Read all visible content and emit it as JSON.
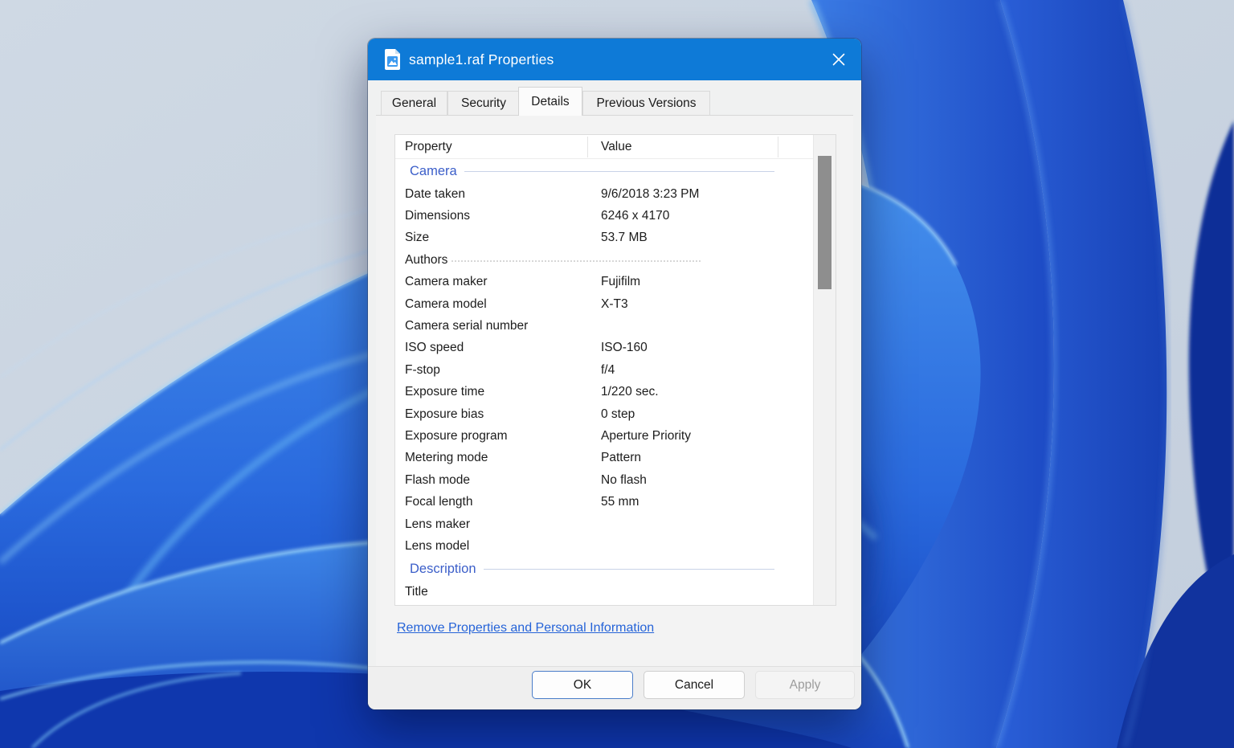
{
  "window": {
    "title": "sample1.raf Properties",
    "icon": "image-file-icon",
    "close": "close"
  },
  "tabs": [
    {
      "label": "General",
      "active": false
    },
    {
      "label": "Security",
      "active": false
    },
    {
      "label": "Details",
      "active": true
    },
    {
      "label": "Previous Versions",
      "active": false
    }
  ],
  "details": {
    "columns": {
      "property": "Property",
      "value": "Value"
    },
    "groups": [
      {
        "name": "Camera",
        "rows": [
          {
            "property": "Date taken",
            "value": "9/6/2018 3:23 PM"
          },
          {
            "property": "Dimensions",
            "value": "6246 x 4170"
          },
          {
            "property": "Size",
            "value": "53.7 MB"
          },
          {
            "property": "Authors",
            "value": "",
            "dashed": true
          },
          {
            "property": "Camera maker",
            "value": "Fujifilm"
          },
          {
            "property": "Camera model",
            "value": "X-T3"
          },
          {
            "property": "Camera serial number",
            "value": ""
          },
          {
            "property": "ISO speed",
            "value": "ISO-160"
          },
          {
            "property": "F-stop",
            "value": "f/4"
          },
          {
            "property": "Exposure time",
            "value": "1/220 sec."
          },
          {
            "property": "Exposure bias",
            "value": "0 step"
          },
          {
            "property": "Exposure program",
            "value": "Aperture Priority"
          },
          {
            "property": "Metering mode",
            "value": "Pattern"
          },
          {
            "property": "Flash mode",
            "value": "No flash"
          },
          {
            "property": "Focal length",
            "value": "55 mm"
          },
          {
            "property": "Lens maker",
            "value": ""
          },
          {
            "property": "Lens model",
            "value": ""
          }
        ]
      },
      {
        "name": "Description",
        "rows": [
          {
            "property": "Title",
            "value": ""
          }
        ]
      }
    ]
  },
  "footer": {
    "remove_link": "Remove Properties and Personal Information",
    "buttons": [
      {
        "label": "OK",
        "state": "default"
      },
      {
        "label": "Cancel",
        "state": "normal"
      },
      {
        "label": "Apply",
        "state": "disabled"
      }
    ]
  },
  "colors": {
    "titlebar": "#0e7ad7",
    "group_header_text": "#3b5ec9",
    "link": "#2563d8",
    "scrollbar_thumb": "#8e8e8e",
    "default_button_border": "#4a7dc9"
  }
}
